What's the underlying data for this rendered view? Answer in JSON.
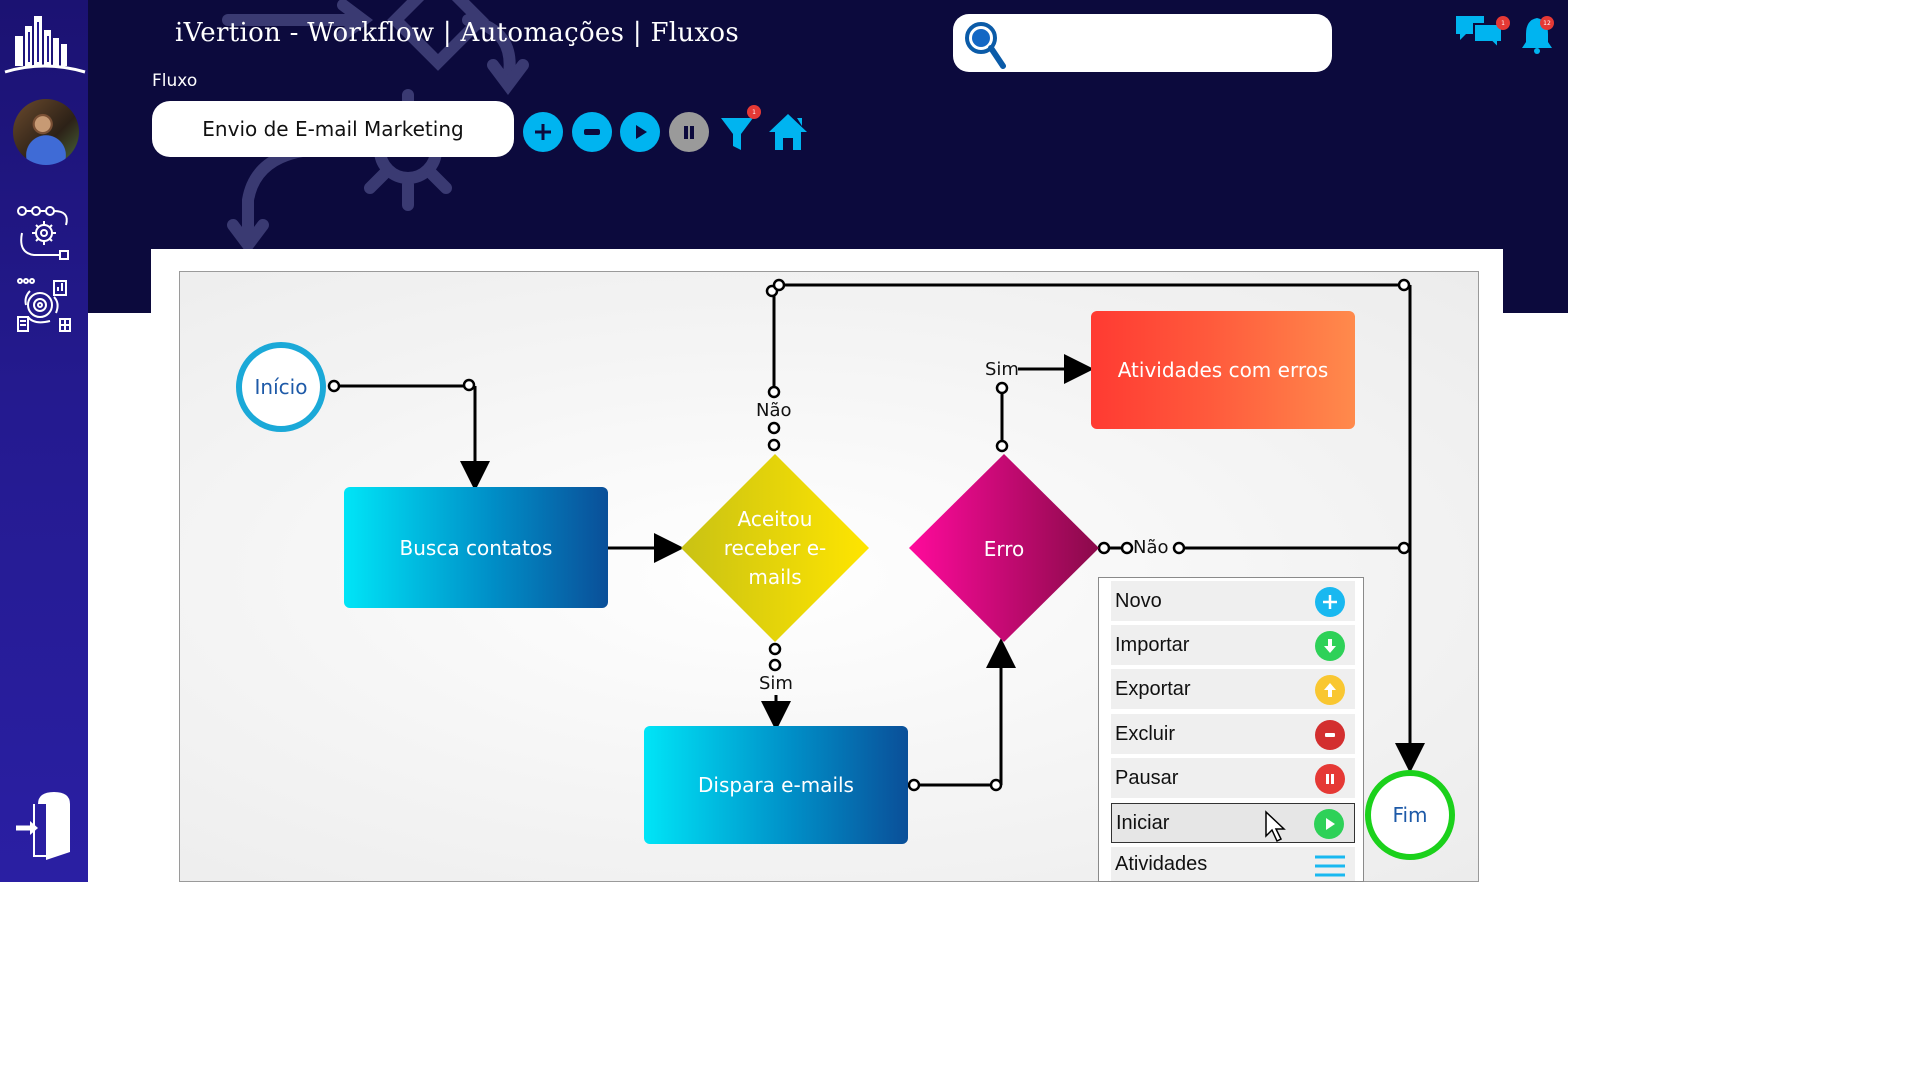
{
  "header": {
    "title": "iVertion - Workflow | Automações | Fluxos",
    "flow_label": "Fluxo",
    "flow_name": "Envio de E-mail Marketing",
    "search_placeholder": "",
    "chat_badge": "1",
    "bell_badge": "12",
    "filter_badge": "1"
  },
  "toolbar": {
    "add": "add-icon",
    "remove": "remove-icon",
    "play": "play-icon",
    "pause": "pause-icon",
    "filter": "filter-icon",
    "home": "home-icon"
  },
  "colors": {
    "sidebar": "#241a8f",
    "header": "#0c0a3d",
    "accent": "#00b4f0",
    "start_ring": "#1ba9d8",
    "end_ring": "#1bd11b",
    "decision_yellow": "#e8d60c",
    "decision_magenta": "#c4006b",
    "error_box": "#ff5a3c"
  },
  "flow": {
    "start": "Início",
    "busca": "Busca contatos",
    "decision1": "Aceitou receber e-mails",
    "decision2": "Erro",
    "dispara": "Dispara e-mails",
    "errors": "Atividades com erros",
    "end": "Fim",
    "label_nao_top": "Não",
    "label_sim_bottom": "Sim",
    "label_sim_erro": "Sim",
    "label_nao_erro": "Não"
  },
  "menu": {
    "items": [
      {
        "label": "Novo",
        "icon": "plus-icon",
        "color": "#19b8f0"
      },
      {
        "label": "Importar",
        "icon": "arrow-down-icon",
        "color": "#2ed158"
      },
      {
        "label": "Exportar",
        "icon": "arrow-up-icon",
        "color": "#f9c731"
      },
      {
        "label": "Excluir",
        "icon": "minus-icon",
        "color": "#d32f2f"
      },
      {
        "label": "Pausar",
        "icon": "pause-icon",
        "color": "#e53935"
      },
      {
        "label": "Iniciar",
        "icon": "play-icon",
        "color": "#2ed158"
      },
      {
        "label": "Atividades",
        "icon": "list-icon",
        "color": "#19b8f0"
      }
    ]
  }
}
